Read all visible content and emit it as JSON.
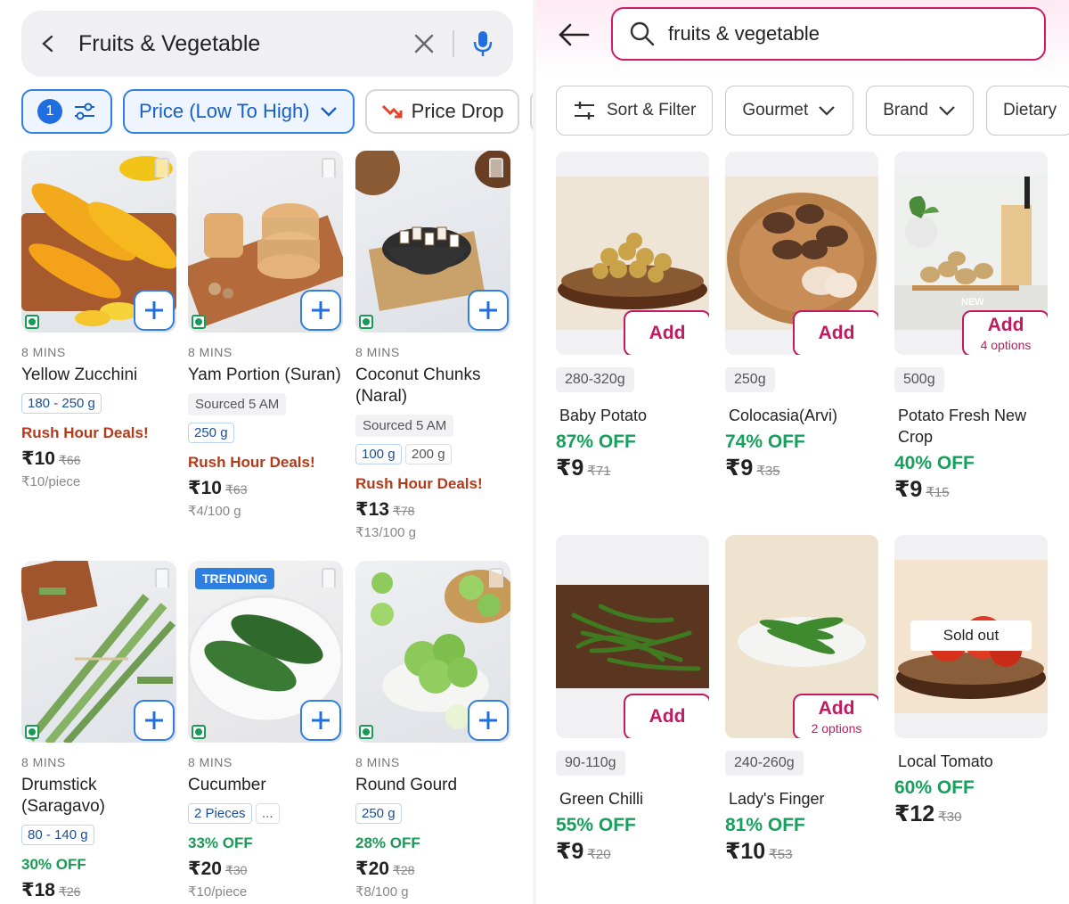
{
  "left": {
    "search": {
      "query": "Fruits & Vegetable",
      "back_icon": "chevron-left-icon",
      "clear_icon": "close-icon",
      "mic_icon": "mic-icon"
    },
    "filters": {
      "count": "1",
      "sort_label": "Price (Low To High)",
      "drop_label": "Price Drop",
      "accent": "#2f7ee0"
    },
    "products": [
      {
        "mins": "8 MINS",
        "name": "Yellow Zucchini",
        "tags": [
          "180 - 250 g"
        ],
        "deal": "Rush Hour Deals!",
        "price": "₹10",
        "mrp": "₹66",
        "unit": "₹10/piece"
      },
      {
        "mins": "8 MINS",
        "name": "Yam Portion (Suran)",
        "sourced": "Sourced 5 AM",
        "tags": [
          "250 g"
        ],
        "deal": "Rush Hour Deals!",
        "price": "₹10",
        "mrp": "₹63",
        "unit": "₹4/100 g"
      },
      {
        "mins": "8 MINS",
        "name": "Coconut Chunks (Naral)",
        "sourced": "Sourced 5 AM",
        "tags": [
          "100 g",
          "200 g"
        ],
        "deal": "Rush Hour Deals!",
        "price": "₹13",
        "mrp": "₹78",
        "unit": "₹13/100 g"
      },
      {
        "mins": "8 MINS",
        "name": "Drumstick (Saragavo)",
        "tags": [
          "80 - 140 g"
        ],
        "deal": "30% OFF",
        "price": "₹18",
        "mrp": "₹26"
      },
      {
        "mins": "8 MINS",
        "name": "Cucumber",
        "trending": "TRENDING",
        "tags": [
          "2 Pieces",
          "..."
        ],
        "deal": "33% OFF",
        "price": "₹20",
        "mrp": "₹30",
        "unit": "₹10/piece"
      },
      {
        "mins": "8 MINS",
        "name": "Round Gourd",
        "tags": [
          "250 g"
        ],
        "deal": "28% OFF",
        "price": "₹20",
        "mrp": "₹28",
        "unit": "₹8/100 g"
      }
    ]
  },
  "right": {
    "search": {
      "query": "fruits & vegetable",
      "back_icon": "arrow-left-icon",
      "search_icon": "search-icon"
    },
    "chips": {
      "sort": "Sort & Filter",
      "gourmet": "Gourmet",
      "brand": "Brand",
      "dietary": "Dietary"
    },
    "accent": "#c21a5e",
    "products": [
      {
        "weight": "280-320g",
        "name": "Baby Potato",
        "off": "87% OFF",
        "price": "₹9",
        "mrp": "₹71",
        "add": "Add"
      },
      {
        "weight": "250g",
        "name": "Colocasia(Arvi)",
        "off": "74% OFF",
        "price": "₹9",
        "mrp": "₹35",
        "add": "Add"
      },
      {
        "weight": "500g",
        "name": "Potato Fresh New Crop",
        "off": "40% OFF",
        "price": "₹9",
        "mrp": "₹15",
        "add": "Add",
        "options": "4 options",
        "new_label": "NEW"
      },
      {
        "weight": "90-110g",
        "name": "Green Chilli",
        "off": "55% OFF",
        "price": "₹9",
        "mrp": "₹20",
        "add": "Add"
      },
      {
        "weight": "240-260g",
        "name": "Lady's Finger",
        "off": "81% OFF",
        "price": "₹10",
        "mrp": "₹53",
        "add": "Add",
        "options": "2 options"
      },
      {
        "name": "Local Tomato",
        "off": "60% OFF",
        "price": "₹12",
        "mrp": "₹30",
        "sold_out": "Sold out"
      }
    ]
  }
}
